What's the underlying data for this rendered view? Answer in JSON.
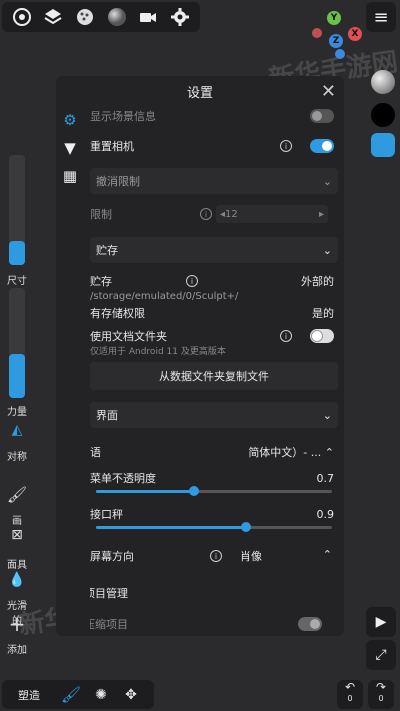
{
  "topbar": {
    "icons": [
      "circle-target-icon",
      "layers-icon",
      "sphere-dots-icon",
      "matcap-sphere-icon",
      "camera-icon",
      "gear-icon"
    ]
  },
  "gizmo": {
    "y": "Y",
    "x": "X",
    "z": "Z",
    "zneg": "Z"
  },
  "left": {
    "size_label": "尺寸",
    "strength_label": "力量",
    "symmetry_label": "对称",
    "paint_label": "画",
    "mask_label": "面具",
    "smooth_label": "光滑的",
    "add_label": "添加"
  },
  "dialog": {
    "title": "设置",
    "rows": {
      "show_scene_info": "显示场景信息",
      "reset_camera": "重置相机",
      "undo_limit": "撤消限制",
      "limit_label": "限制",
      "limit_value": "12",
      "storage_header": "贮存",
      "storage_label": "贮存",
      "storage_value": "外部的",
      "storage_path": "/storage/emulated/0/Sculpt+/",
      "has_permission": "有存储权限",
      "has_permission_value": "是的",
      "use_doc_folder": "使用文档文件夹",
      "use_doc_folder_note": "仅适用于 Android 11 及更高版本",
      "copy_button": "从数据文件夹复制文件",
      "ui_header": "界面",
      "language_label": "语",
      "language_value": "简体中文）- ...",
      "menu_opacity_label": "菜单不透明度",
      "menu_opacity_value": "0.7",
      "joystick_label": "接口秤",
      "joystick_value": "0.9",
      "orientation_label": "屏幕方向",
      "orientation_value": "肖像",
      "project_mgmt": "项目管理",
      "compress_project": "压缩项目"
    },
    "menu_opacity": 0.7,
    "joystick_scale": 0.9
  },
  "bottom": {
    "sculpt_label": "塑造",
    "undo_count": "0",
    "redo_count": "0"
  },
  "watermark": "新华手游网",
  "colors": {
    "accent": "#2e9be0",
    "panel": "#232325",
    "bg": "#2b2b2d"
  }
}
